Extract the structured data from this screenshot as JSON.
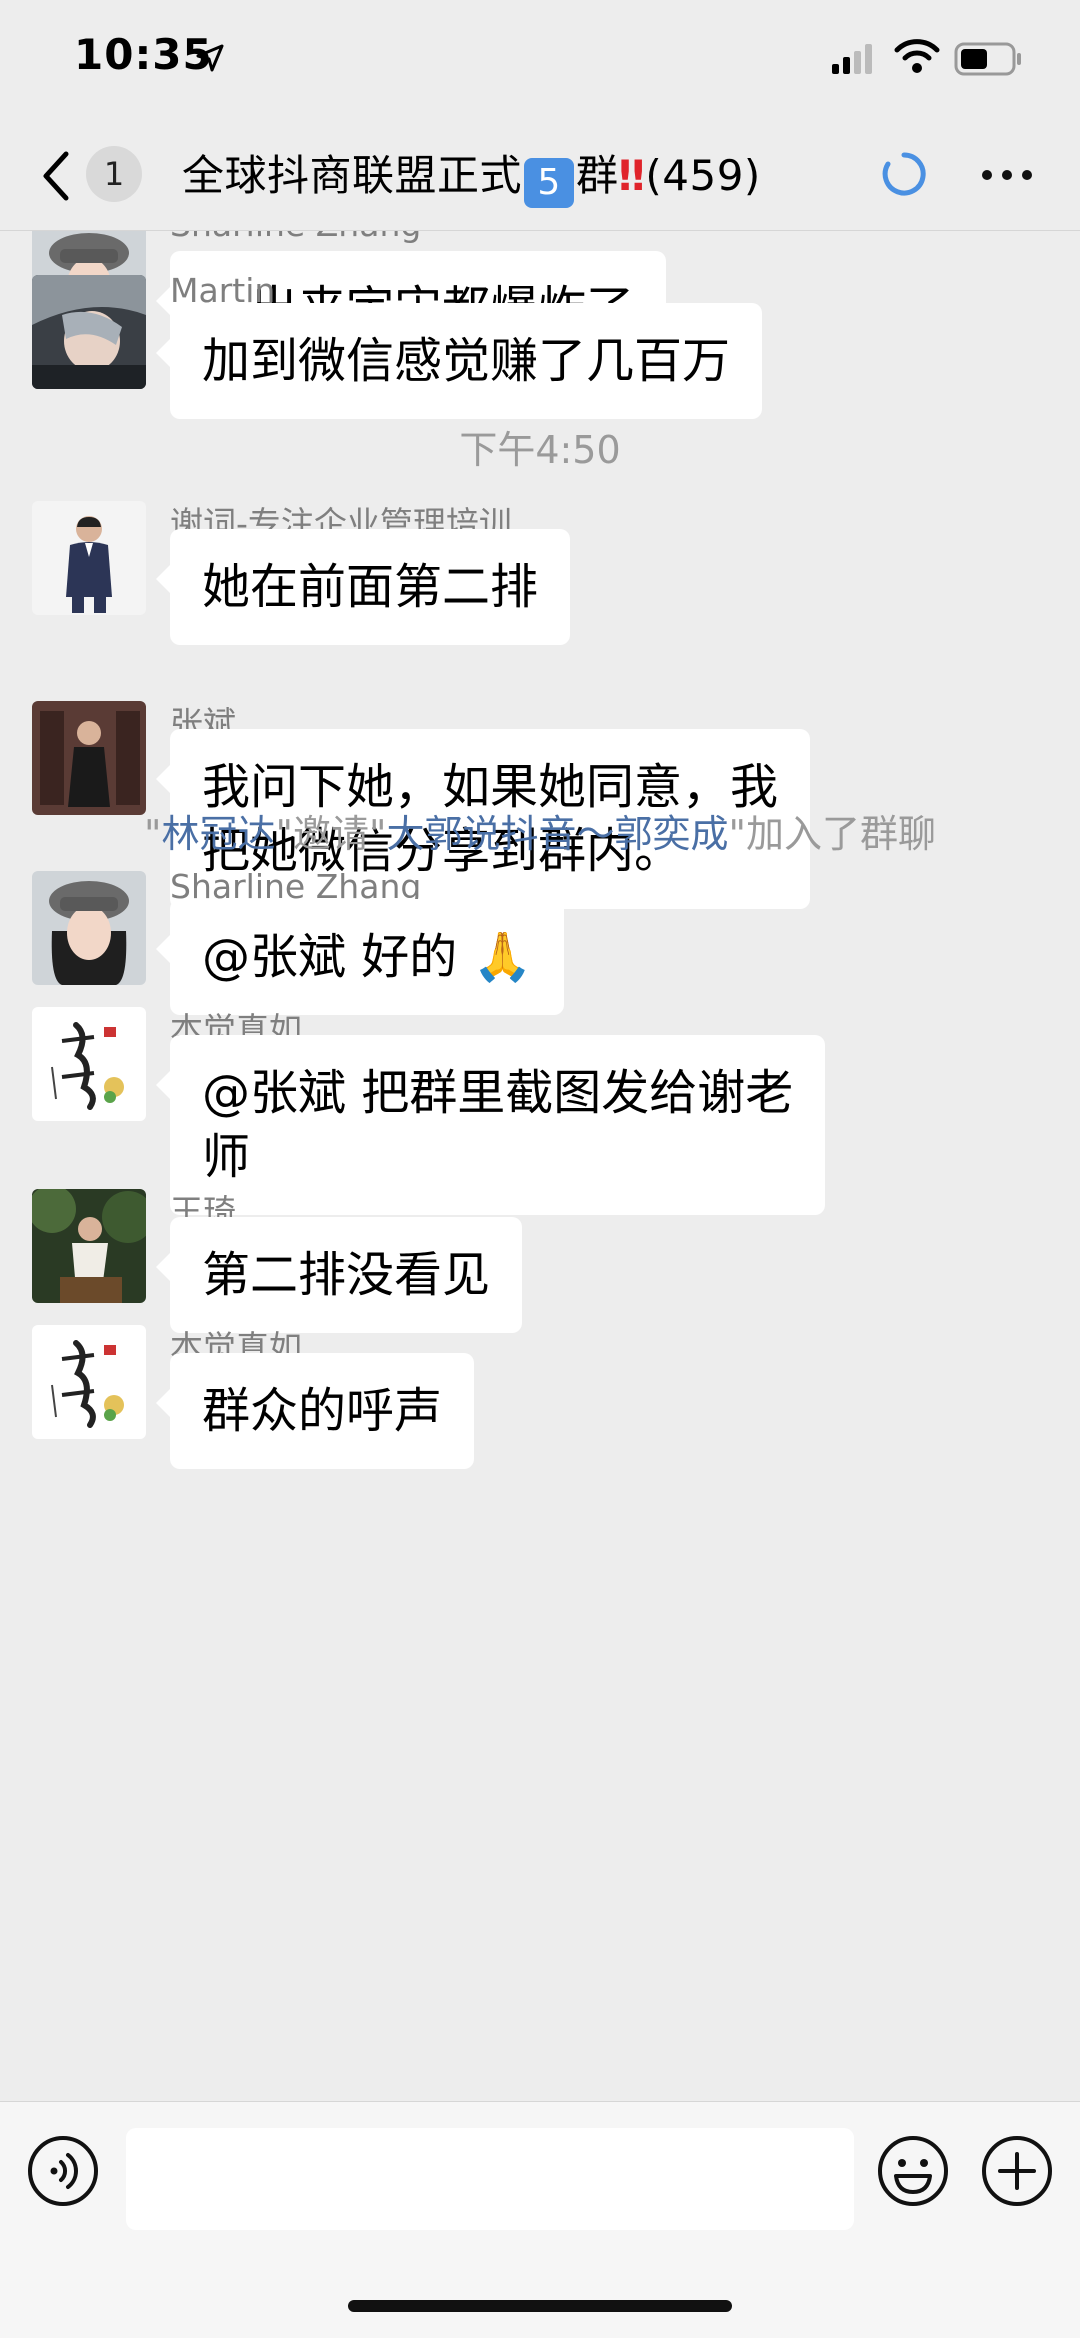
{
  "status_bar": {
    "time": "10:35"
  },
  "nav": {
    "unread_count": "1",
    "title_prefix": "全球抖商联盟正式",
    "title_num": "5",
    "title_group": "群",
    "title_bang": "‼",
    "title_count": "(459)"
  },
  "messages": [
    {
      "sender": "Sharline Zhang",
      "text": "一出来宇宙都爆炸了",
      "avatar": "woman-avatar"
    },
    {
      "sender": "Martin",
      "text": "加到微信感觉赚了几百万",
      "avatar": "photo-avatar"
    },
    {
      "sender": "谢词-专注企业管理培训",
      "text": "她在前面第二排",
      "avatar": "suit-man-avatar"
    },
    {
      "sender": "张斌",
      "text_line1": "我问下她，如果她同意，我",
      "text_line2": "把她微信分享到群内。",
      "avatar": "man-avatar"
    },
    {
      "sender": "Sharline Zhang",
      "text": "@张斌 好的 🙏",
      "avatar": "woman-avatar"
    },
    {
      "sender": "本觉真如",
      "text_line1": "@张斌 把群里截图发给谢老",
      "text_line2": "师",
      "avatar": "calligraphy-avatar"
    },
    {
      "sender": "王琦",
      "text": "第二排没看见",
      "avatar": "outdoor-avatar"
    },
    {
      "sender": "本觉真如",
      "text": "群众的呼声",
      "avatar": "calligraphy-avatar"
    }
  ],
  "timestamp": "下午4:50",
  "system_note": {
    "q1": "\"",
    "inviter": "林冠达",
    "mid": "\"邀请\"",
    "invitee": "大郭说抖音～郭奕成",
    "end": "\"加入了群聊"
  },
  "colors": {
    "background": "#ededed",
    "bubble": "#ffffff",
    "link": "#4a6fa5",
    "accent": "#4a90e2"
  }
}
